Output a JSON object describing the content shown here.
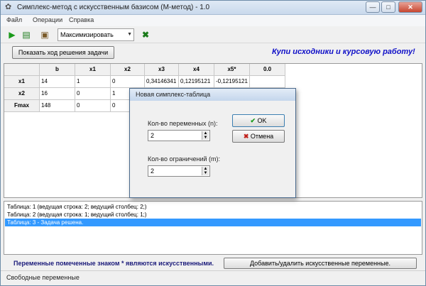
{
  "window": {
    "title": "Симплекс-метод с искусственным базисом (М-метод) - 1.0"
  },
  "menu": [
    "Файл",
    "Операции",
    "Справка"
  ],
  "toolbar": {
    "mode_select": "Максимизировать"
  },
  "buttons": {
    "show_solution": "Показать ход решения задачи",
    "add_remove_artificial": "Добавить/удалить искусственные переменные."
  },
  "promo": "Купи исходники и курсовую работу!",
  "grid": {
    "headers": [
      "",
      "b",
      "x1",
      "x2",
      "x3",
      "x4",
      "x5*",
      "0.0"
    ],
    "rows": [
      [
        "x1",
        "14",
        "1",
        "0",
        "0,34146341",
        "0,12195121",
        "-0,12195121",
        ""
      ],
      [
        "x2",
        "16",
        "0",
        "1",
        "",
        "",
        "",
        ""
      ],
      [
        "Fmax",
        "148",
        "0",
        "0",
        "",
        "",
        "",
        ""
      ]
    ]
  },
  "log": [
    "Таблица: 1 (ведущая строка: 2; ведущий столбец: 2;)",
    "Таблица: 2 (ведущая строка: 1; ведущий столбец: 1;)",
    "Таблица: 3 - Задача решена."
  ],
  "note": "Переменные помеченные знаком * являются искусственными.",
  "status": "Свободные переменные",
  "dialog": {
    "title": "Новая симплекс-таблица",
    "vars_label": "Кол-во переменных (n):",
    "vars_value": "2",
    "limits_label": "Кол-во ограничений (m):",
    "limits_value": "2",
    "ok": "OK",
    "cancel": "Отмена"
  },
  "icons": [
    "app-icon",
    "run-icon",
    "table-icon",
    "new-icon",
    "excel-icon",
    "check-icon",
    "cancel-icon"
  ],
  "colors": {
    "accent": "#3399ff",
    "promo": "#1010c8"
  }
}
